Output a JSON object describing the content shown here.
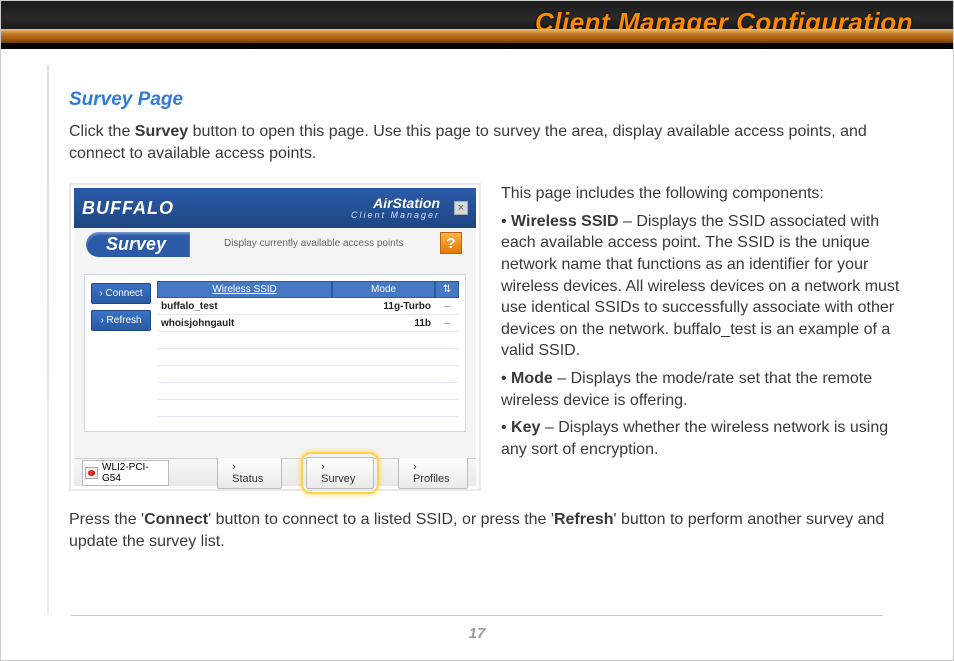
{
  "header": {
    "title": "Client Manager Configuration"
  },
  "section": {
    "title": "Survey Page"
  },
  "intro": {
    "pre": "Click the ",
    "bold": "Survey",
    "post": " button to open this page. Use this page to survey the area, display available access points, and connect to available access points."
  },
  "screenshot": {
    "brand": "BUFFALO",
    "product_top": "AirStation",
    "product_sub": "Client Manager",
    "close_glyph": "×",
    "pill": "Survey",
    "subtitle": "Display currently available access points",
    "help_glyph": "?",
    "side_buttons": {
      "connect": "› Connect",
      "refresh": "› Refresh"
    },
    "columns": {
      "ssid": "Wireless SSID",
      "mode": "Mode",
      "key": "⇅"
    },
    "rows": [
      {
        "ssid": "buffalo_test",
        "mode": "11g-Turbo",
        "key": "–"
      },
      {
        "ssid": "whoisjohngault",
        "mode": "11b",
        "key": "–"
      }
    ],
    "device": "WLI2-PCI-G54",
    "footer_buttons": {
      "status": "› Status",
      "survey": "› Survey",
      "profiles": "› Profiles"
    }
  },
  "description": {
    "lead": "This page includes the following components:",
    "items": [
      {
        "label": "Wireless SSID",
        "text": "Displays the SSID associated with each available access point. The SSID is the unique network name that functions as an identifier for your wireless devices. All wireless devices on a network must use identical SSIDs to successfully associate with other devices on the network. buffalo_test is an example of a valid SSID."
      },
      {
        "label": "Mode",
        "text": "Displays the mode/rate set that the remote wireless device is offering."
      },
      {
        "label": "Key",
        "text": "Displays whether the wireless network is using any sort of encryption."
      }
    ]
  },
  "closing": {
    "p1a": "Press the '",
    "b1": "Connect",
    "p1b": "' button to connect to a listed SSID, or press the '",
    "b2": "Refresh",
    "p1c": "' button to perform another survey and update the survey list."
  },
  "page_number": "17"
}
